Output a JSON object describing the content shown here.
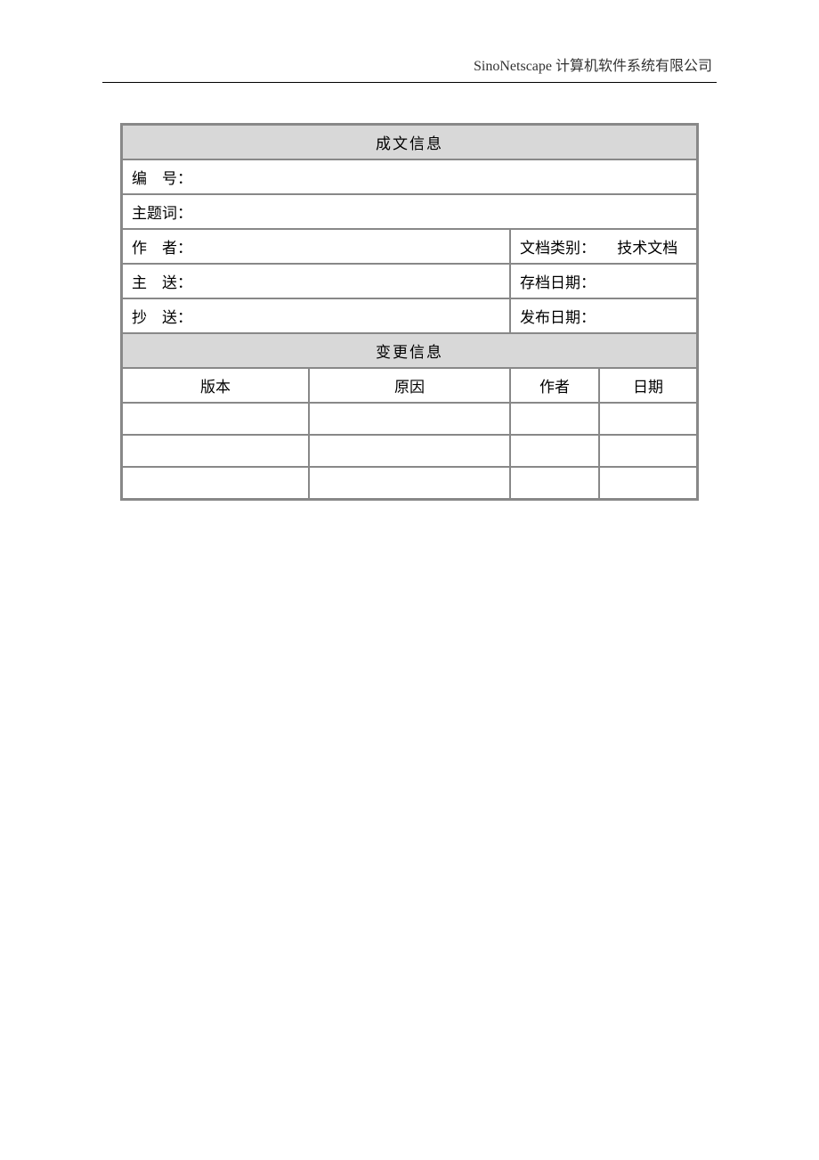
{
  "header": {
    "company": "SinoNetscape 计算机软件系统有限公司"
  },
  "sections": {
    "doc_info_title": "成文信息",
    "change_info_title": "变更信息"
  },
  "fields": {
    "number_label": "编　号：",
    "number_value": "",
    "subject_label": "主题词：",
    "subject_value": "",
    "author_label": "作　者：",
    "author_value": "",
    "doc_type_label": "文档类别：",
    "doc_type_value": "技术文档",
    "main_send_label": "主　送：",
    "main_send_value": "",
    "archive_date_label": "存档日期：",
    "archive_date_value": "",
    "cc_label": "抄　送：",
    "cc_value": "",
    "publish_date_label": "发布日期：",
    "publish_date_value": ""
  },
  "change_table": {
    "headers": {
      "version": "版本",
      "reason": "原因",
      "author": "作者",
      "date": "日期"
    },
    "rows": [
      {
        "version": "",
        "reason": "",
        "author": "",
        "date": ""
      },
      {
        "version": "",
        "reason": "",
        "author": "",
        "date": ""
      },
      {
        "version": "",
        "reason": "",
        "author": "",
        "date": ""
      }
    ]
  }
}
